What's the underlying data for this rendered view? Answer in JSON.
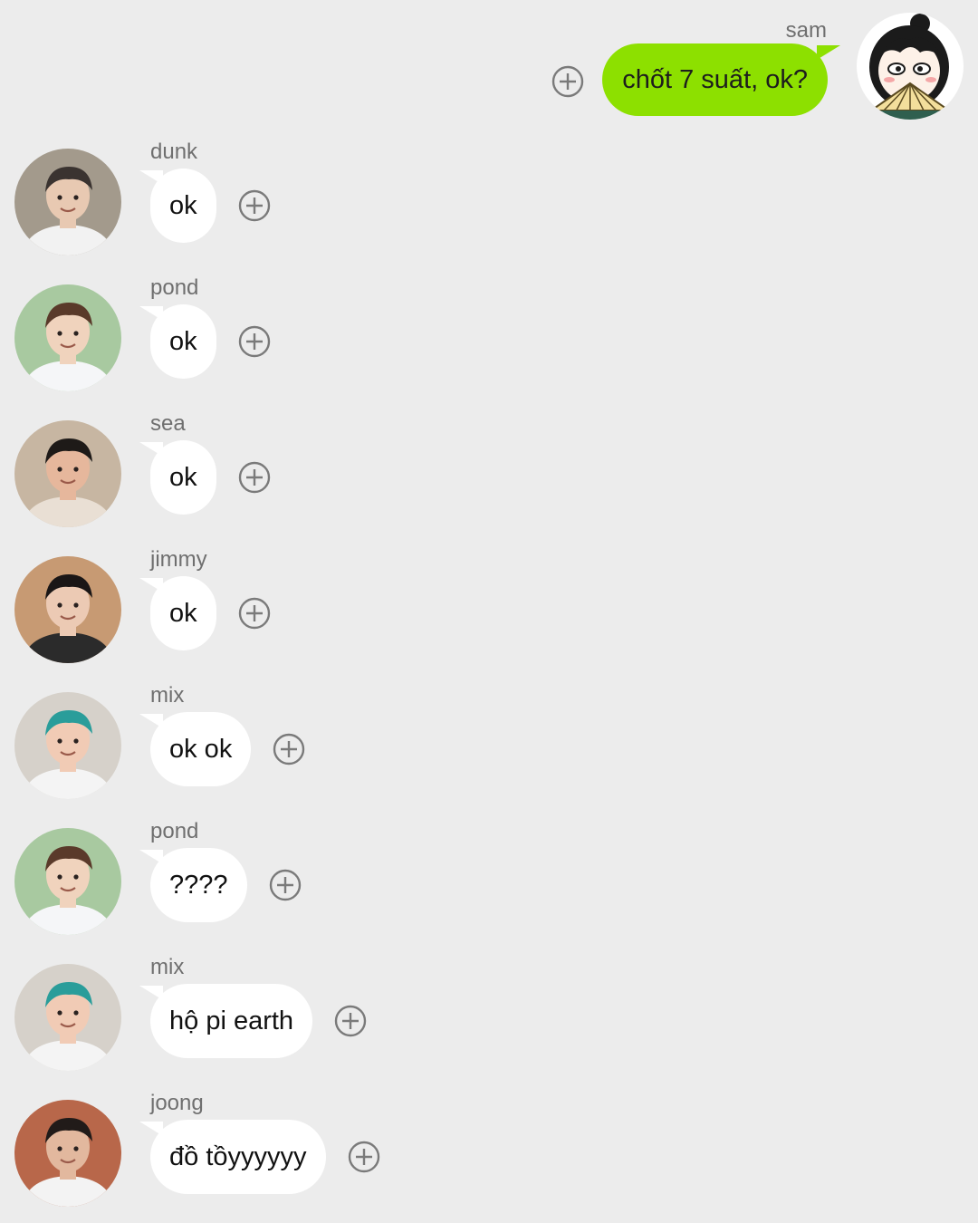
{
  "outgoing": {
    "sender": "sam",
    "text": "chốt 7 suất, ok?",
    "avatar_icon": "cartoon-girl-fan-avatar",
    "bubble_color": "#8de000"
  },
  "messages": [
    {
      "sender": "dunk",
      "text": "ok",
      "avatar_icon": "mirror-selfie-avatar",
      "skin": "#e8c9b2",
      "hair": "#3a3330",
      "shirt": "#f2f2f2",
      "bg": "#a39a8c"
    },
    {
      "sender": "pond",
      "text": "ok",
      "avatar_icon": "microphone-photo-avatar",
      "skin": "#f0d3bd",
      "hair": "#5a3a2a",
      "shirt": "#f5f6f8",
      "bg": "#a8c9a0"
    },
    {
      "sender": "sea",
      "text": "ok",
      "avatar_icon": "smiling-selfie-avatar",
      "skin": "#e6b79c",
      "hair": "#1e1a18",
      "shirt": "#e9dfd4",
      "bg": "#c7b6a2"
    },
    {
      "sender": "jimmy",
      "text": "ok",
      "avatar_icon": "tilted-head-photo-avatar",
      "skin": "#eccab4",
      "hair": "#1a1616",
      "shirt": "#2b2b2b",
      "bg": "#c79a73"
    },
    {
      "sender": "mix",
      "text": "ok ok",
      "avatar_icon": "teal-cap-avatar",
      "skin": "#f1cbb5",
      "hair": "#2a9d9a",
      "shirt": "#f4f4f4",
      "bg": "#d6d1ca"
    },
    {
      "sender": "pond",
      "text": "????",
      "avatar_icon": "microphone-photo-avatar",
      "skin": "#f0d3bd",
      "hair": "#5a3a2a",
      "shirt": "#f5f6f8",
      "bg": "#a8c9a0"
    },
    {
      "sender": "mix",
      "text": "hộ pi earth",
      "avatar_icon": "teal-cap-avatar",
      "skin": "#f1cbb5",
      "hair": "#2a9d9a",
      "shirt": "#f4f4f4",
      "bg": "#d6d1ca"
    },
    {
      "sender": "joong",
      "text": "đồ tồyyyyyy",
      "avatar_icon": "brick-wall-photo-avatar",
      "skin": "#e2b89e",
      "hair": "#211b19",
      "shirt": "#f3f3f3",
      "bg": "#b8674a"
    }
  ],
  "icons": {
    "add_reaction": "add-reaction-icon"
  },
  "colors": {
    "background": "#ececec",
    "incoming_bubble": "#ffffff",
    "sender_name": "#6f6f6f",
    "plus_icon": "#7a7a7a"
  }
}
